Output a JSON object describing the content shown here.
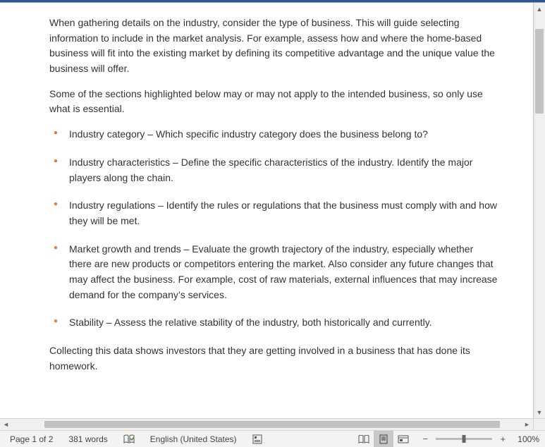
{
  "document": {
    "p1": "When gathering details on the industry, consider the type of business. This will guide selecting information to include in the market analysis. For example, assess how and where the home-based business will fit into the existing market by defining its competitive advantage and the unique value the business will offer.",
    "p2": "Some of the sections highlighted below may or may not apply to the intended business, so only use what is essential.",
    "bullets": [
      "Industry category – Which specific industry category does the business belong to?",
      "Industry characteristics – Define the specific characteristics of the industry. Identify the major players along the chain.",
      "Industry regulations – Identify the rules or regulations that the business must comply with and how they will be met.",
      "Market growth and trends – Evaluate the growth trajectory of the industry, especially whether there are new products or competitors entering the market. Also consider any future changes that may affect the business. For example, cost of raw materials, external influences that may increase demand for the company’s services.",
      "Stability – Assess the relative stability of the industry, both historically and currently."
    ],
    "p3": "Collecting this data shows investors that they are getting involved in a business that has done its homework."
  },
  "status": {
    "page_info": "Page 1 of 2",
    "word_count": "381 words",
    "language": "English (United States)",
    "zoom_pct": "100%"
  },
  "colors": {
    "bullet": "#e8792f",
    "title_bar": "#2b579a"
  }
}
